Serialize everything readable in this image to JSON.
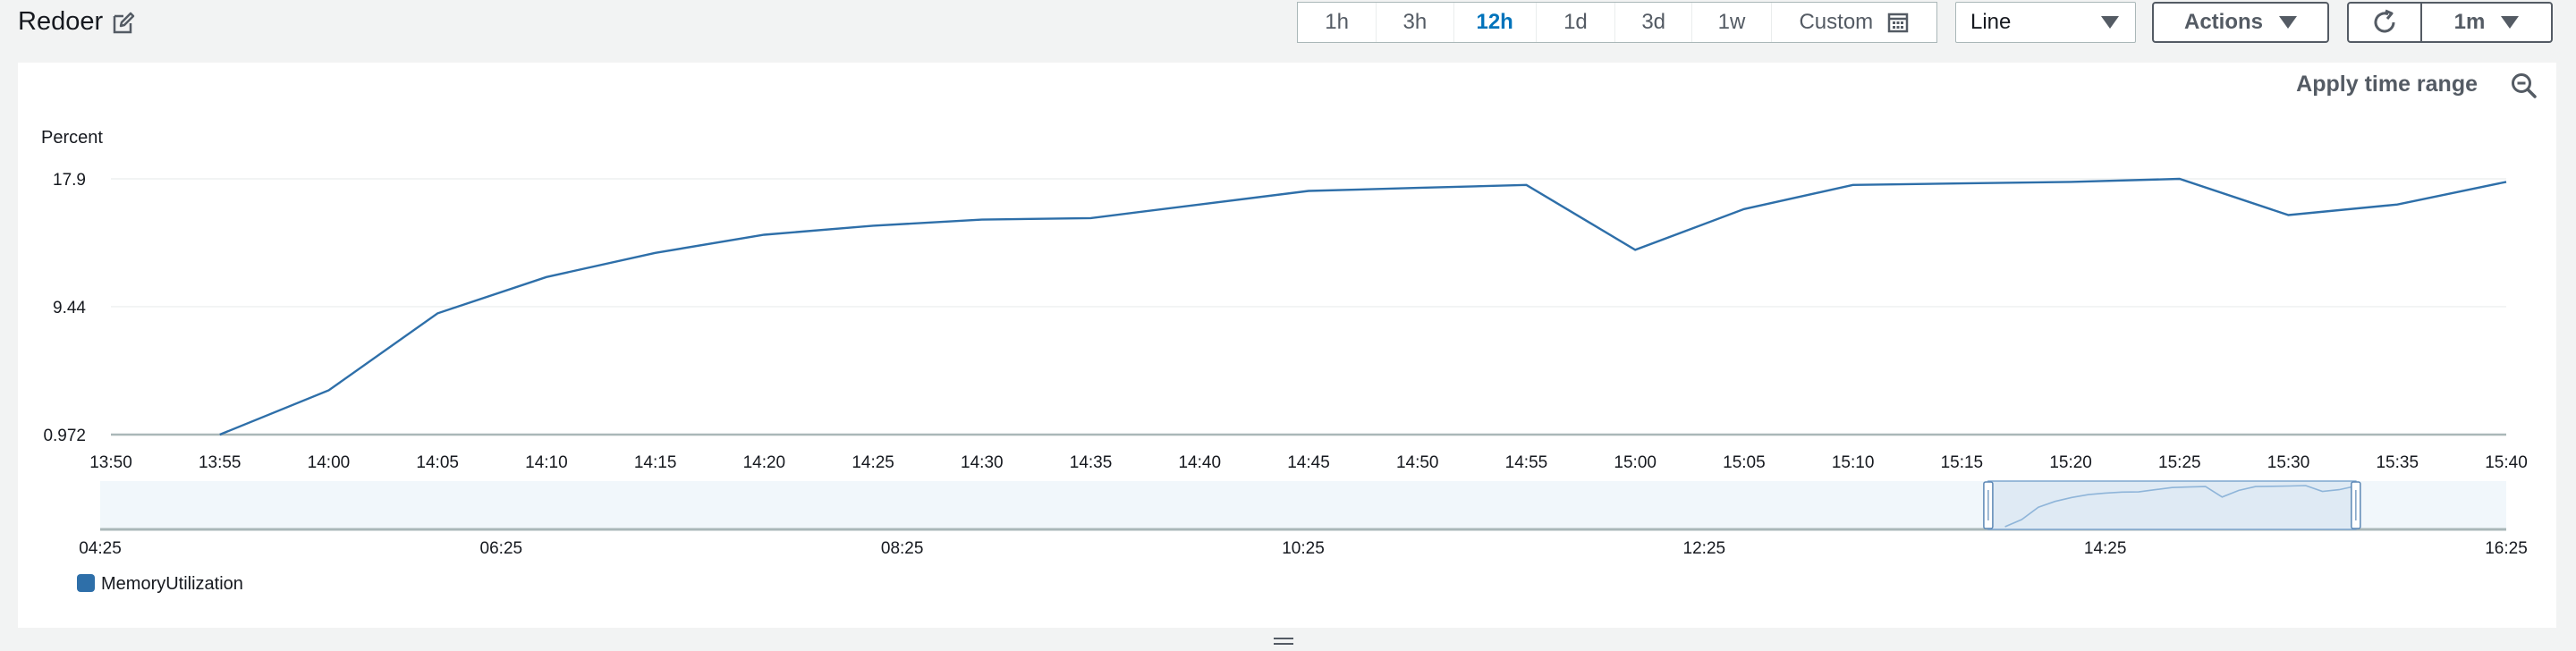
{
  "header": {
    "title": "Redoer",
    "period_options": [
      "1h",
      "3h",
      "12h",
      "1d",
      "3d",
      "1w"
    ],
    "active_period": "12h",
    "custom_label": "Custom",
    "chart_type_select": "Line",
    "actions_label": "Actions",
    "refresh_interval": "1m"
  },
  "panel": {
    "apply_time_range_label": "Apply time range"
  },
  "colors": {
    "series": "#2e6fa9",
    "active_period": "#0073bb",
    "navigator_fill": "#f1f7fb",
    "navigator_selection": "#dfeaf4"
  },
  "chart_data": {
    "type": "line",
    "title": "",
    "xlabel": "",
    "ylabel": "Percent",
    "y_ticks": [
      "17.9",
      "9.44",
      "0.972"
    ],
    "ylim": [
      0.972,
      17.9
    ],
    "grid": true,
    "legend_position": "bottom-left",
    "x_ticks": [
      "13:50",
      "13:55",
      "14:00",
      "14:05",
      "14:10",
      "14:15",
      "14:20",
      "14:25",
      "14:30",
      "14:35",
      "14:40",
      "14:45",
      "14:50",
      "14:55",
      "15:00",
      "15:05",
      "15:10",
      "15:15",
      "15:20",
      "15:25",
      "15:30",
      "15:35",
      "15:40"
    ],
    "series": [
      {
        "name": "MemoryUtilization",
        "x": [
          "13:55",
          "14:00",
          "14:05",
          "14:10",
          "14:15",
          "14:20",
          "14:25",
          "14:30",
          "14:35",
          "14:40",
          "14:45",
          "14:50",
          "14:55",
          "15:00",
          "15:05",
          "15:10",
          "15:15",
          "15:20",
          "15:25",
          "15:30",
          "15:35",
          "15:40"
        ],
        "values": [
          0.97,
          3.9,
          9.0,
          11.4,
          13.0,
          14.2,
          14.8,
          15.2,
          15.3,
          16.2,
          17.1,
          17.3,
          17.5,
          13.2,
          15.9,
          17.5,
          17.6,
          17.7,
          17.9,
          15.5,
          16.2,
          17.7
        ]
      }
    ],
    "navigator": {
      "x_ticks": [
        "04:25",
        "06:25",
        "08:25",
        "10:25",
        "12:25",
        "14:25",
        "16:25"
      ],
      "selection": [
        "13:50",
        "15:40"
      ]
    }
  }
}
